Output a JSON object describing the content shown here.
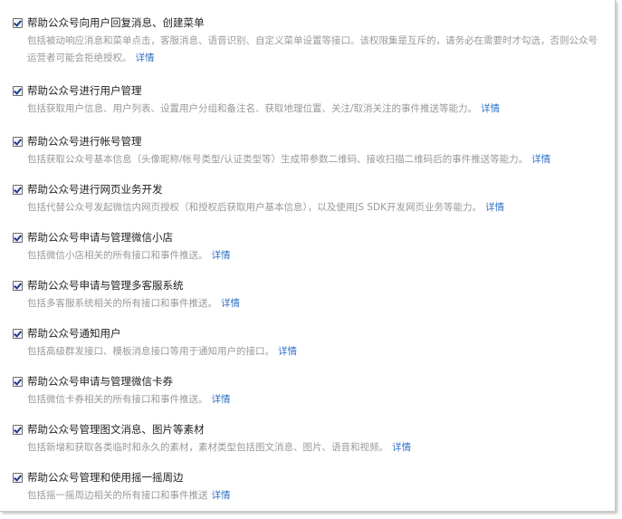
{
  "permissions": [
    {
      "label": "帮助公众号向用户回复消息、创建菜单",
      "description": "包括被动响应消息和菜单点击，客服消息、语音识别、自定义菜单设置等接口。该权限集是互斥的，请务必在需要时才勾选，否则公众号运营者可能会拒绝授权。",
      "link": "详情"
    },
    {
      "label": "帮助公众号进行用户管理",
      "description": "包括获取用户信息、用户列表、设置用户分组和备注名、获取地理位置、关注/取消关注的事件推送等能力。",
      "link": "详情"
    },
    {
      "label": "帮助公众号进行帐号管理",
      "description": "包括获取公众号基本信息（头像昵称/帐号类型/认证类型等）生成带参数二维码、接收扫描二维码后的事件推送等能力。",
      "link": "详情"
    },
    {
      "label": "帮助公众号进行网页业务开发",
      "description": "包括代替公众号发起微信内网页授权（和授权后获取用户基本信息），以及使用JS SDK开发网页业务等能力。",
      "link": "详情"
    },
    {
      "label": "帮助公众号申请与管理微信小店",
      "description": "包括微信小店相关的所有接口和事件推送。",
      "link": "详情"
    },
    {
      "label": "帮助公众号申请与管理多客服系统",
      "description": "包括多客服系统相关的所有接口和事件推送。",
      "link": "详情"
    },
    {
      "label": "帮助公众号通知用户",
      "description": "包括高级群发接口、模板消息接口等用于通知用户的接口。",
      "link": "详情"
    },
    {
      "label": "帮助公众号申请与管理微信卡券",
      "description": "包括微信卡券相关的所有接口和事件推送。",
      "link": "详情"
    },
    {
      "label": "帮助公众号管理图文消息、图片等素材",
      "description": "包括新增和获取各类临时和永久的素材，素材类型包括图文消息、图片、语音和视频。",
      "link": "详情"
    },
    {
      "label": "帮助公众号管理和使用摇一摇周边",
      "description": "包括摇一摇周边相关的所有接口和事件推送",
      "link": "详情"
    }
  ],
  "colors": {
    "link": "#2f73c8",
    "description": "#999999",
    "title": "#222222",
    "check": "#1b3d8f"
  }
}
